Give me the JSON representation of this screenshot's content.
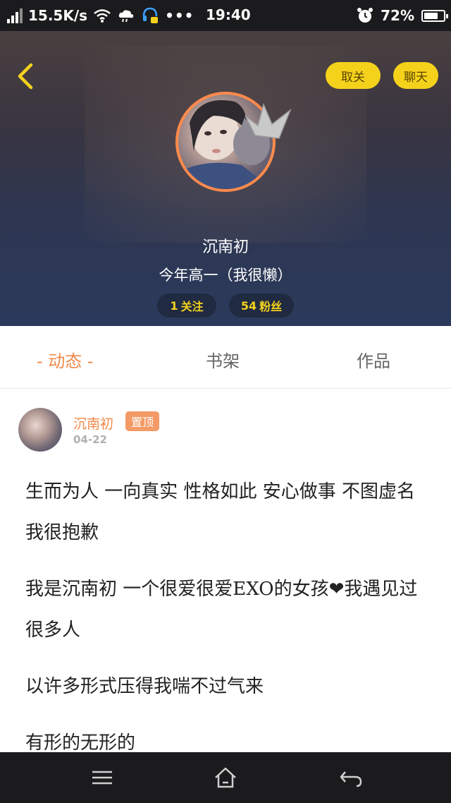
{
  "status_bar": {
    "network_speed": "15.5K/s",
    "time": "19:40",
    "battery_percent": "72%",
    "battery_level": 0.72,
    "icons": [
      "signal-icon",
      "wifi-icon",
      "cloud-icon",
      "headset-icon",
      "more-dots-icon",
      "alarm-icon",
      "battery-icon"
    ]
  },
  "header": {
    "unfollow_label": "取关",
    "chat_label": "聊天",
    "user_name": "沉南初",
    "bio": "今年高一（我很懒）",
    "following_count": "1",
    "following_label": "关注",
    "fans_count": "54",
    "fans_label": "粉丝"
  },
  "tabs": {
    "dynamic": "- 动态 -",
    "shelf": "书架",
    "works": "作品"
  },
  "post": {
    "author": "沉南初",
    "pinned_label": "置顶",
    "date": "04-22",
    "paragraphs": [
      "生而为人 一向真实 性格如此 安心做事 不图虚名 我很抱歉",
      "我是沉南初 一个很爱很爱EXO的女孩❤我遇见过很多人",
      "以许多形式压得我喘不过气来",
      "有形的无形的"
    ]
  },
  "colors": {
    "accent_orange": "#f0894a",
    "pill_yellow": "#f4d21c",
    "avatar_ring": "#ff8a4c",
    "badge_orange": "#f39a66"
  }
}
